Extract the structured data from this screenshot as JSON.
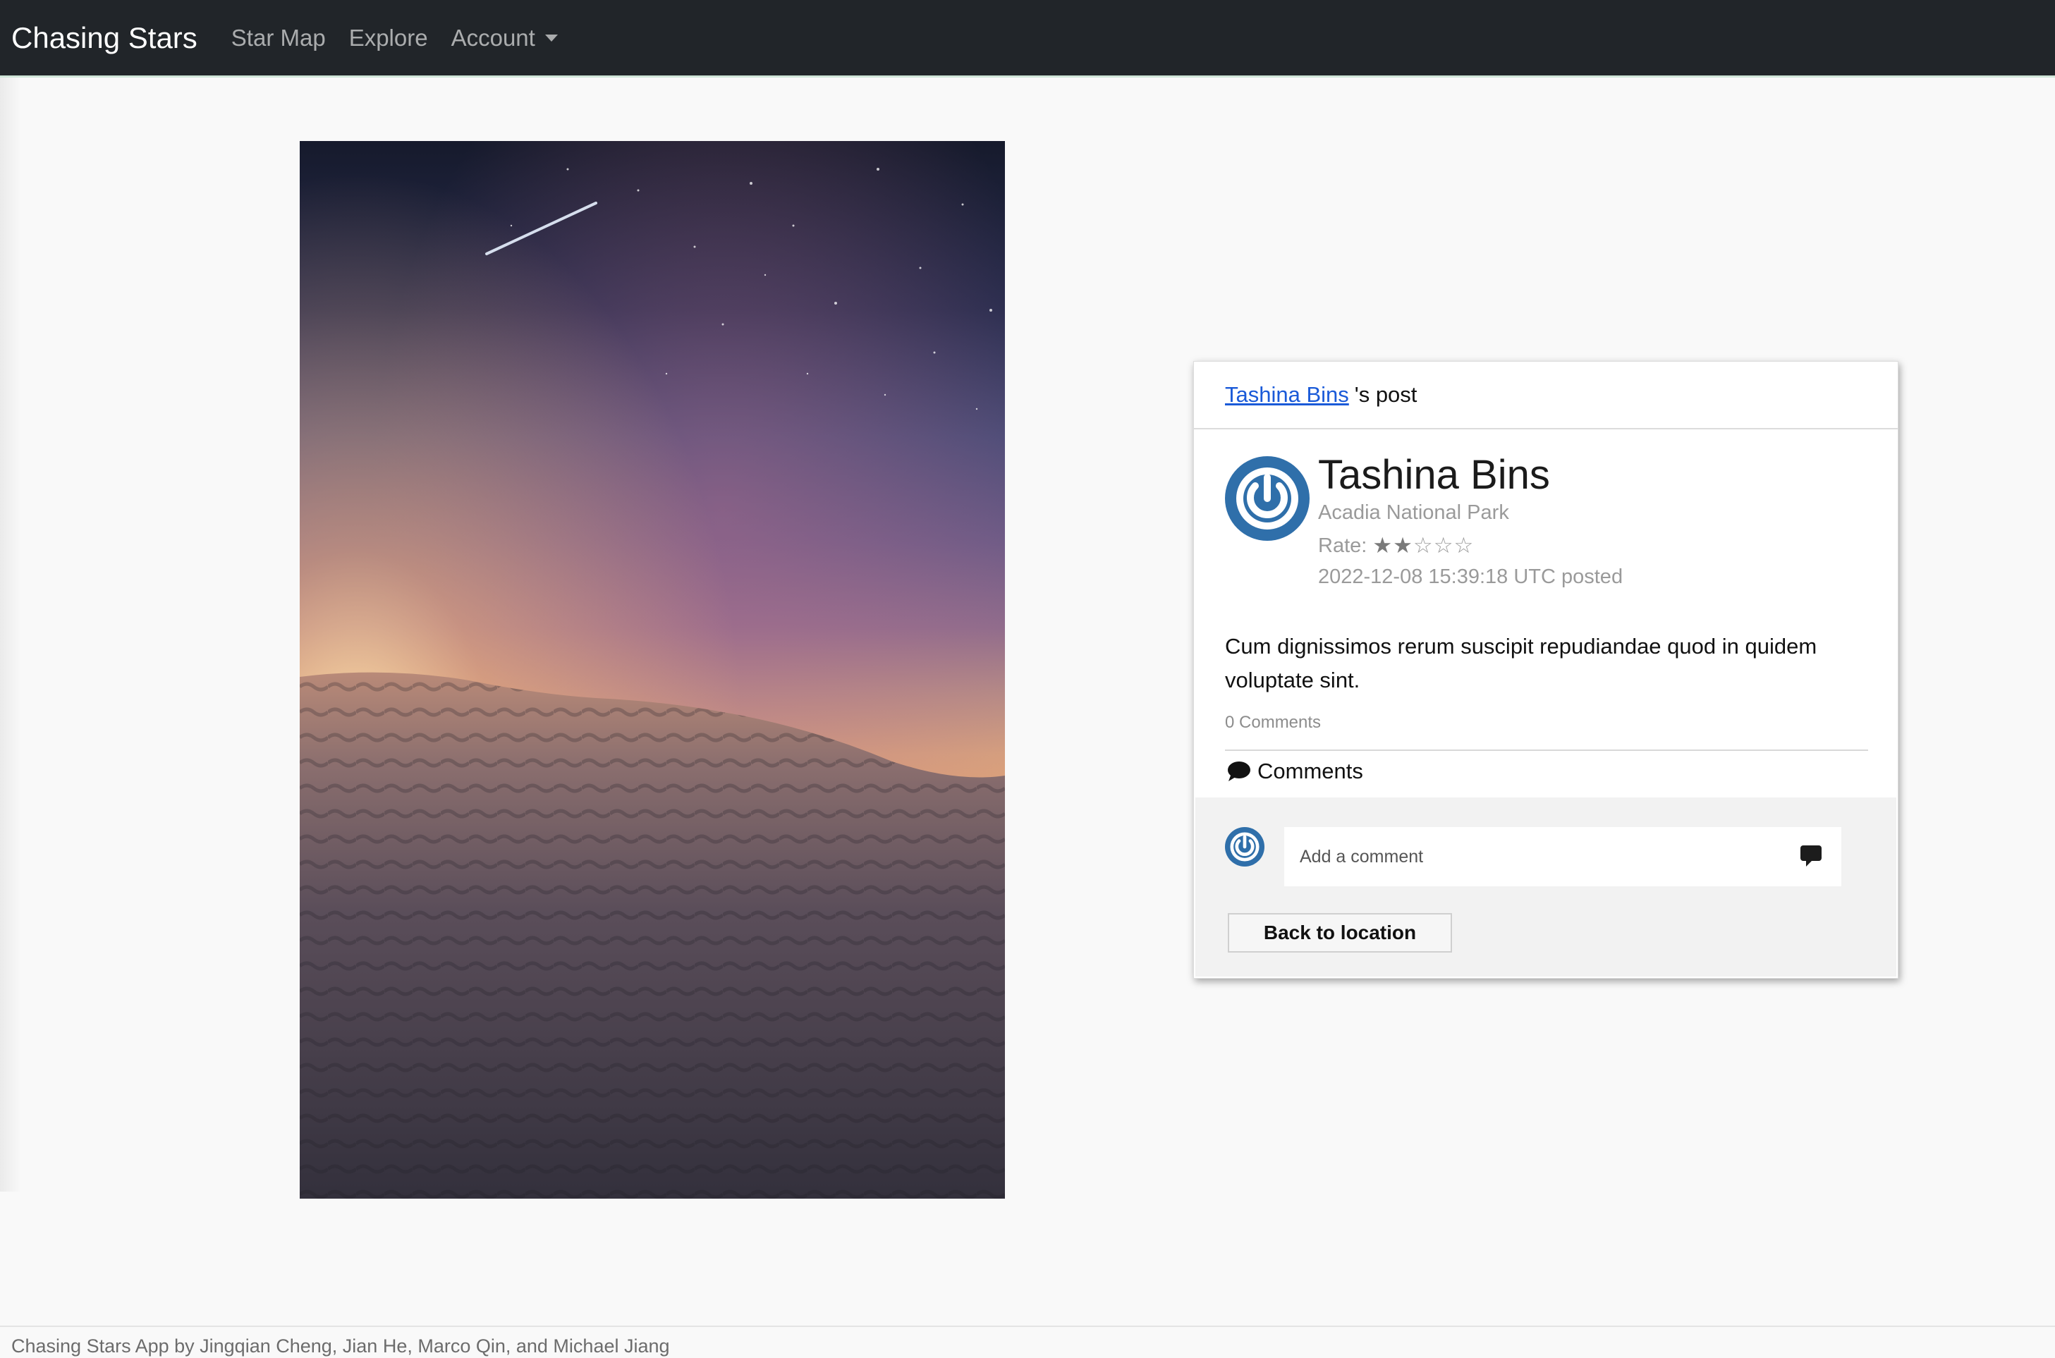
{
  "navbar": {
    "brand": "Chasing Stars",
    "links": [
      {
        "label": "Star Map"
      },
      {
        "label": "Explore"
      },
      {
        "label": "Account"
      }
    ]
  },
  "post": {
    "header_author": "Tashina Bins",
    "header_suffix": "'s post",
    "author_name": "Tashina Bins",
    "location": "Acadia National Park",
    "rate_label": "Rate:",
    "rating": 2,
    "rating_max": 5,
    "posted": "2022-12-08 15:39:18 UTC posted",
    "content": "Cum dignissimos rerum suscipit repudiandae quod in quidem voluptate sint.",
    "comment_count": "0 Comments",
    "comments_title": "Comments",
    "comment_placeholder": "Add a comment",
    "back_button": "Back to location"
  },
  "footer": {
    "text": "Chasing Stars App by Jingqian Cheng, Jian He, Marco Qin, and Michael Jiang"
  },
  "colors": {
    "navbar": "#212529",
    "link": "#1a5ad8",
    "avatar": "#2f6faa"
  },
  "icons": [
    "caret-down-icon",
    "power-logo-icon",
    "comment-icon",
    "send-comment-icon"
  ]
}
